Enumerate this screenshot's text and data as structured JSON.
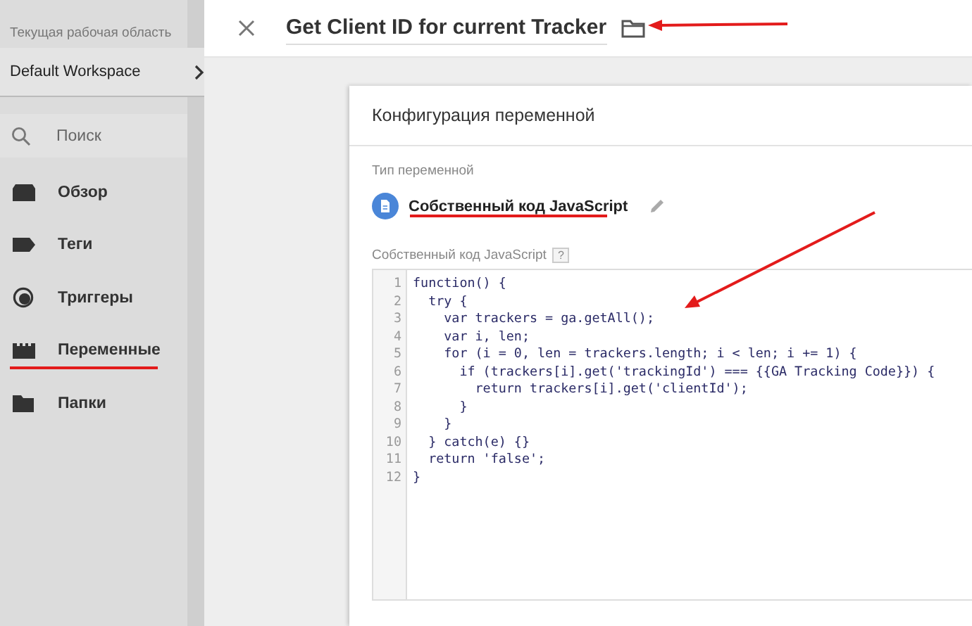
{
  "sidebar": {
    "workspace_label": "Текущая рабочая область",
    "workspace": "Default Workspace",
    "search": {
      "placeholder": "Поиск"
    },
    "items": [
      {
        "label": "Обзор",
        "kind": "overview"
      },
      {
        "label": "Теги",
        "kind": "tag"
      },
      {
        "label": "Триггеры",
        "kind": "trigger"
      },
      {
        "label": "Переменные",
        "kind": "blocks",
        "annotated": true
      },
      {
        "label": "Папки",
        "kind": "folder"
      }
    ]
  },
  "header": {
    "title": "Get Client ID for current Tracker"
  },
  "card": {
    "title": "Конфигурация переменной",
    "type_label": "Тип переменной",
    "type_value": "Собственный код JavaScript",
    "code_label": "Собственный код JavaScript",
    "help": "?",
    "code": [
      {
        "number": "1",
        "text": "function() {"
      },
      {
        "number": "2",
        "text": "  try {"
      },
      {
        "number": "3",
        "text": "    var trackers = ga.getAll();"
      },
      {
        "number": "4",
        "text": "    var i, len;"
      },
      {
        "number": "5",
        "text": "    for (i = 0, len = trackers.length; i < len; i += 1) {"
      },
      {
        "number": "6",
        "text": "      if (trackers[i].get('trackingId') === {{GA Tracking Code}}) {"
      },
      {
        "number": "7",
        "text": "        return trackers[i].get('clientId');"
      },
      {
        "number": "8",
        "text": "      }"
      },
      {
        "number": "9",
        "text": "    }"
      },
      {
        "number": "10",
        "text": "  } catch(e) {}"
      },
      {
        "number": "11",
        "text": "  return 'false';"
      },
      {
        "number": "12",
        "text": "}"
      }
    ]
  }
}
